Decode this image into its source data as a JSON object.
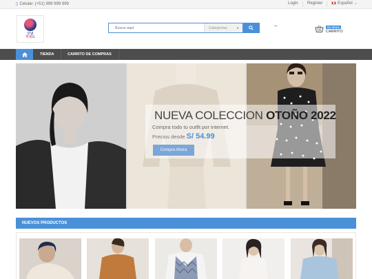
{
  "topbar": {
    "phone": "Celular: (+51) 999 999 999",
    "login": "Login",
    "register": "Register",
    "language": "Español"
  },
  "header": {
    "logo_line1": "안녕",
    "logo_line2": "하세요",
    "search_placeholder": "Busca aquí",
    "category_label": "Categorías",
    "cart_badge": "No items",
    "cart_label": "CARRITO",
    "dash": "–"
  },
  "nav": {
    "items": [
      "TIENDA",
      "CARRITO DE COMPRAS"
    ]
  },
  "hero": {
    "title_light": "NUEVA COLECCION ",
    "title_bold": "OTOÑO 2022",
    "subtitle": "Compra todo tu outfit por internet.",
    "price_prefix": "Precios desde ",
    "price": "S/ 54.99",
    "button": "Compra Ahora"
  },
  "products": {
    "heading": "NUEVOS PRODUCTOS"
  },
  "colors": {
    "accent": "#4a90d9",
    "nav_bg": "#4d4d4d"
  }
}
